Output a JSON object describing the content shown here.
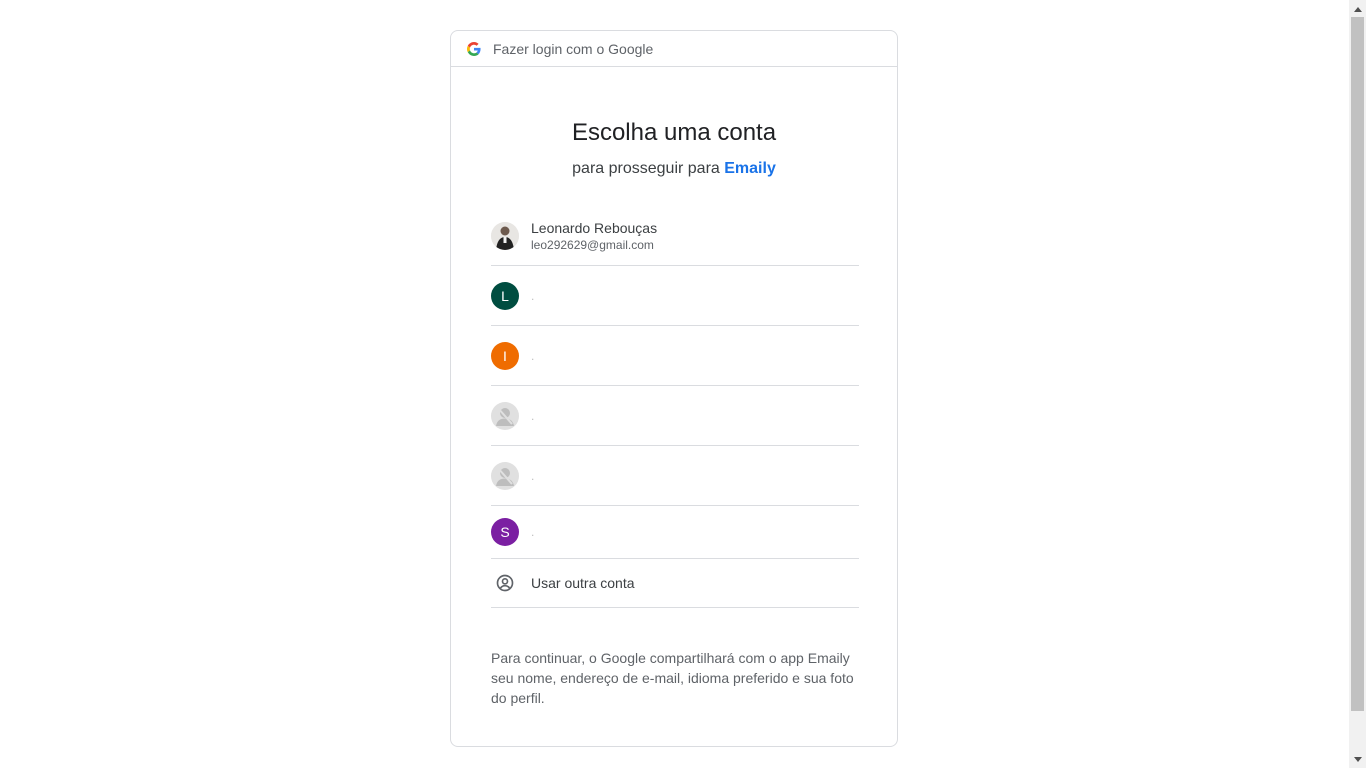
{
  "header": {
    "title": "Fazer login com o Google"
  },
  "main": {
    "title": "Escolha uma conta",
    "subtitle_prefix": "para prosseguir para",
    "app_name": "Emaily"
  },
  "accounts": [
    {
      "name": "Leonardo Rebouças",
      "email": "leo292629@gmail.com",
      "avatar": "photo"
    },
    {
      "initial": "L",
      "color": "#004d40",
      "trailing": "."
    },
    {
      "initial": "I",
      "color": "#ef6c00",
      "trailing": "."
    },
    {
      "avatar": "default-person-icon",
      "color": "#e0e0e0",
      "trailing": "."
    },
    {
      "avatar": "default-person-icon",
      "color": "#e0e0e0",
      "trailing": "."
    },
    {
      "initial": "S",
      "color": "#7b1fa2",
      "trailing": "."
    }
  ],
  "other_account": {
    "label": "Usar outra conta",
    "icon": "account-circle-icon"
  },
  "disclaimer": "Para continuar, o Google compartilhará com o app Emaily seu nome, endereço de e-mail, idioma preferido e sua foto do perfil.",
  "colors": {
    "link": "#1a73e8",
    "border": "#dadce0",
    "text_secondary": "#5f6368"
  }
}
